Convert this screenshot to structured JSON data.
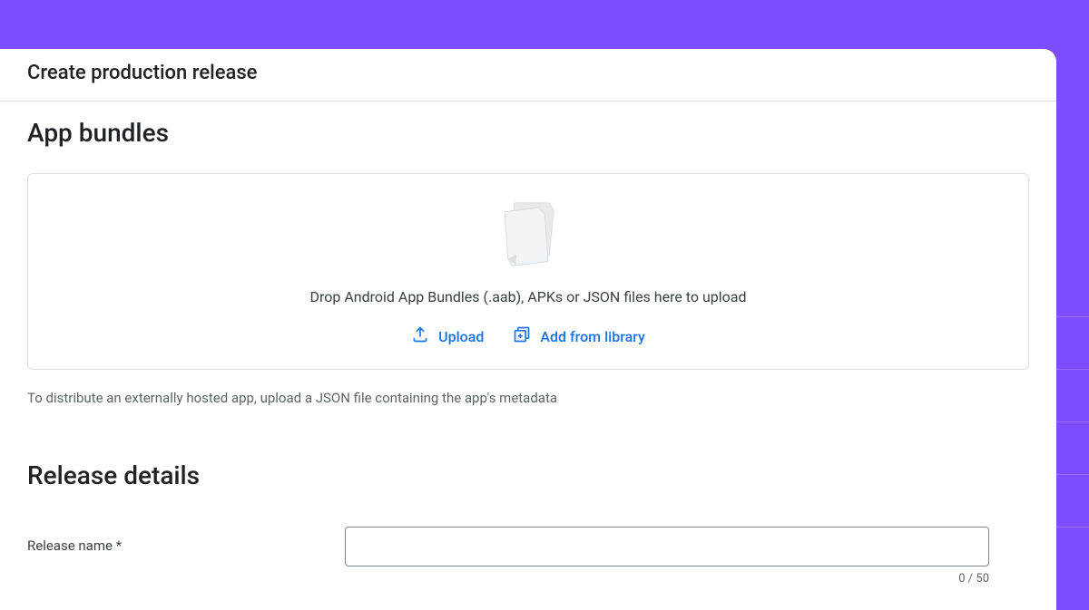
{
  "header": {
    "title": "Create production release"
  },
  "appBundles": {
    "sectionTitle": "App bundles",
    "dropzoneText": "Drop Android App Bundles (.aab), APKs or JSON files here to upload",
    "uploadLabel": "Upload",
    "addFromLibraryLabel": "Add from library",
    "helperText": "To distribute an externally hosted app, upload a JSON file containing the app's metadata"
  },
  "releaseDetails": {
    "sectionTitle": "Release details",
    "nameLabel": "Release name *",
    "nameValue": "",
    "charCounter": "0 / 50"
  }
}
